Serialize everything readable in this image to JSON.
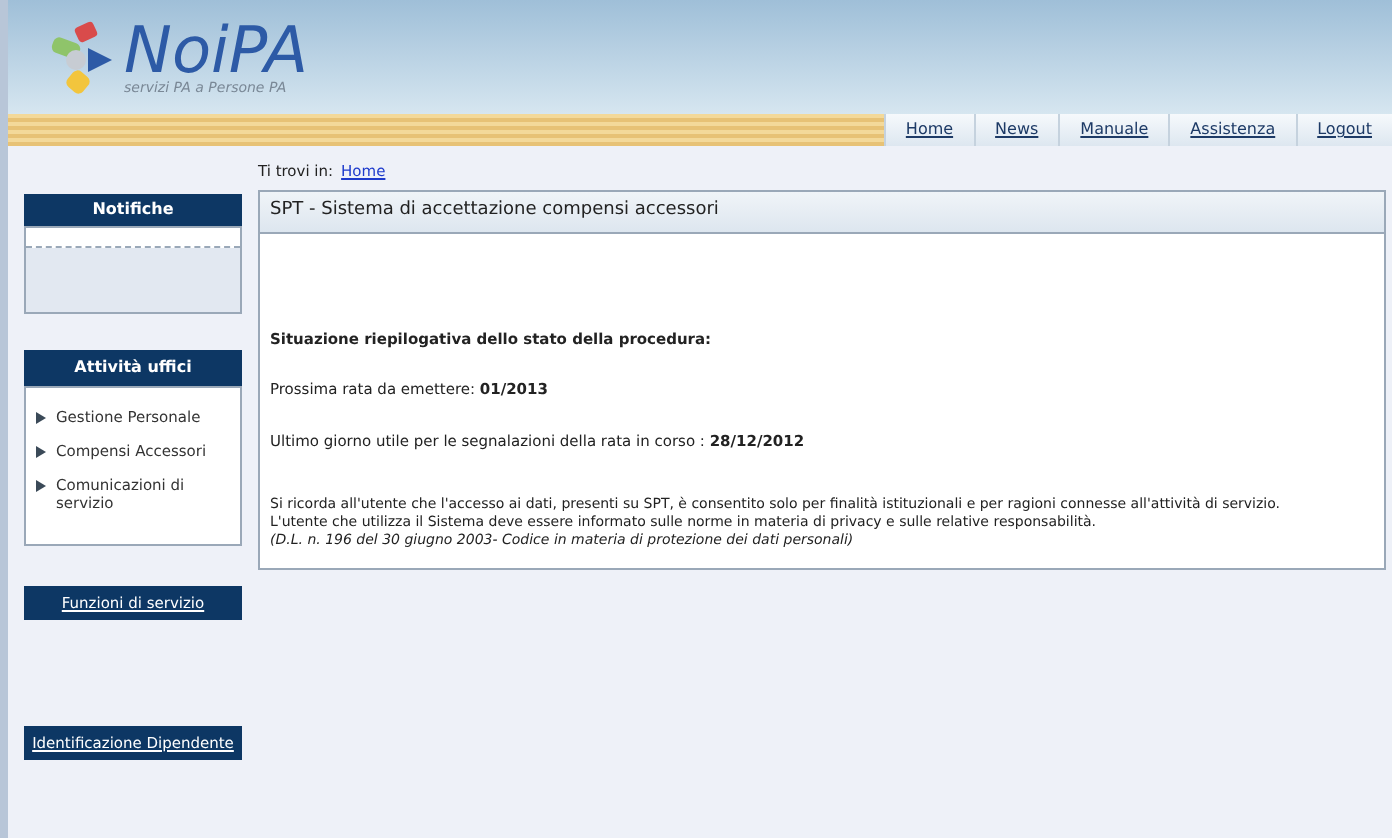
{
  "logo": {
    "name": "NoiPA",
    "tagline": "servizi PA a Persone PA"
  },
  "nav": [
    {
      "label": "Home"
    },
    {
      "label": "News"
    },
    {
      "label": "Manuale"
    },
    {
      "label": "Assistenza"
    },
    {
      "label": "Logout"
    }
  ],
  "breadcrumb": {
    "prefix": "Ti trovi in:",
    "link": "Home"
  },
  "sidebar": {
    "notifiche": {
      "title": "Notifiche"
    },
    "attivita": {
      "title": "Attività uffici",
      "items": [
        {
          "label": "Gestione Personale"
        },
        {
          "label": "Compensi Accessori"
        },
        {
          "label": "Comunicazioni di servizio"
        }
      ]
    },
    "links": [
      {
        "label": "Funzioni di servizio"
      },
      {
        "label": "Identificazione Dipendente"
      }
    ]
  },
  "main": {
    "title": "SPT - Sistema di accettazione compensi accessori",
    "heading": "Situazione riepilogativa dello stato della procedura:",
    "lines": [
      "Prossima rata da emettere: **01/2013**",
      "Ultimo giorno utile per le segnalazioni della rata in corso : **28/12/2012**"
    ],
    "notice": [
      "Si ricorda all'utente che l'accesso ai dati, presenti su SPT, è consentito solo per finalità  istituzionali e per ragioni connesse all'attività  di servizio.",
      "L'utente che utilizza il Sistema deve essere informato sulle norme in materia di privacy e sulle relative responsabilità."
    ],
    "legal": "(D.L. n. 196 del 30 giugno 2003- Codice in materia di protezione dei dati personali)"
  }
}
